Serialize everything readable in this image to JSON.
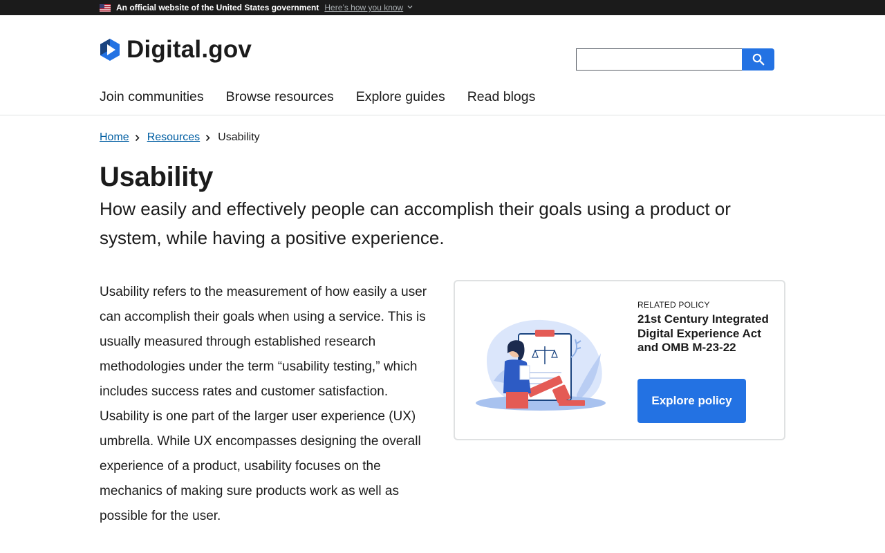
{
  "banner": {
    "text": "An official website of the United States government",
    "link": "Here’s how you know"
  },
  "header": {
    "logo_text": "Digital.gov",
    "search_value": "",
    "nav": [
      "Join communities",
      "Browse resources",
      "Explore guides",
      "Read blogs"
    ]
  },
  "breadcrumb": {
    "items": [
      "Home",
      "Resources"
    ],
    "current": "Usability"
  },
  "page": {
    "title": "Usability",
    "lede": "How easily and effectively people can accomplish their goals using a product or system, while having a positive experience.",
    "body": "Usability refers to the measurement of how easily a user can accomplish their goals when using a service. This is usually measured through established research methodologies under the term “usability testing,” which includes success rates and customer satisfaction. Usability is one part of the larger user experience (UX) umbrella. While UX encompasses designing the overall experience of a product, usability focuses on the mechanics of making sure products work as well as possible for the user."
  },
  "policy_card": {
    "kicker": "RELATED POLICY",
    "title": "21st Century Integrated Digital Experience Act and OMB M-23-22",
    "button": "Explore policy"
  },
  "colors": {
    "primary": "#2372e3",
    "link": "#005ea2",
    "banner_bg": "#1b1b1b",
    "text": "#1b1b1b",
    "border": "#dfe1e2"
  },
  "icons": {
    "flag": "us-flag-icon",
    "chevron": "chevron-down-icon",
    "search": "search-icon",
    "breadcrumb_sep": "chevron-right-icon",
    "logo": "play-hexagon-icon"
  }
}
